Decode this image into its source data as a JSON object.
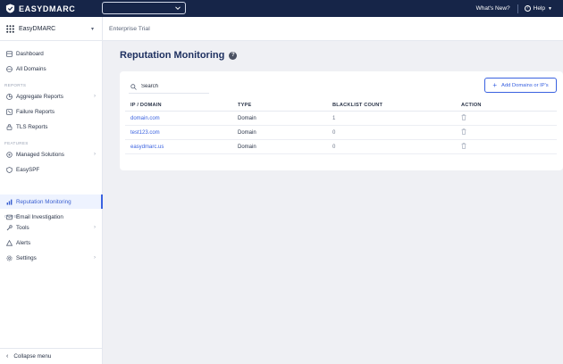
{
  "topbar": {
    "brand": "EASYDMARC",
    "whats_new": "What's New?",
    "help": "Help"
  },
  "sidebar": {
    "app_name": "EasyDMARC",
    "items_main": [
      {
        "label": "Dashboard",
        "icon": "dashboard-icon"
      },
      {
        "label": "All Domains",
        "icon": "domains-icon"
      }
    ],
    "section_reports": "REPORTS",
    "items_reports": [
      {
        "label": "Aggregate Reports",
        "icon": "aggregate-icon",
        "arrow": "›"
      },
      {
        "label": "Failure Reports",
        "icon": "failure-icon"
      },
      {
        "label": "TLS Reports",
        "icon": "tls-icon"
      }
    ],
    "section_features": "FEATURES",
    "items_features": [
      {
        "label": "Managed Solutions",
        "icon": "managed-icon",
        "arrow": "›"
      },
      {
        "label": "EasySPF",
        "icon": "spf-icon"
      },
      {
        "label": "Reputation Monitoring",
        "icon": "reputation-icon",
        "active": true
      },
      {
        "label": "Email Investigation",
        "icon": "investigation-icon"
      }
    ],
    "section_other": "OTHER",
    "items_other": [
      {
        "label": "Tools",
        "icon": "tools-icon",
        "arrow": "›"
      },
      {
        "label": "Alerts",
        "icon": "alerts-icon"
      },
      {
        "label": "Settings",
        "icon": "settings-icon",
        "arrow": "›"
      }
    ],
    "collapse": "Collapse menu"
  },
  "subbar": {
    "plan": "Enterprise Trial"
  },
  "main": {
    "title": "Reputation Monitoring",
    "search_placeholder": "Search",
    "add_button": "Add Domains or IP's",
    "columns": [
      "IP / DOMAIN",
      "TYPE",
      "BLACKLIST COUNT",
      "ACTION"
    ],
    "rows": [
      {
        "domain": "domain.com",
        "type": "Domain",
        "count": "1"
      },
      {
        "domain": "test123.com",
        "type": "Domain",
        "count": "0"
      },
      {
        "domain": "easydmarc.us",
        "type": "Domain",
        "count": "0"
      }
    ]
  },
  "colors": {
    "topbar": "#162548",
    "accent": "#3a62e0",
    "title": "#1d2f5f"
  }
}
